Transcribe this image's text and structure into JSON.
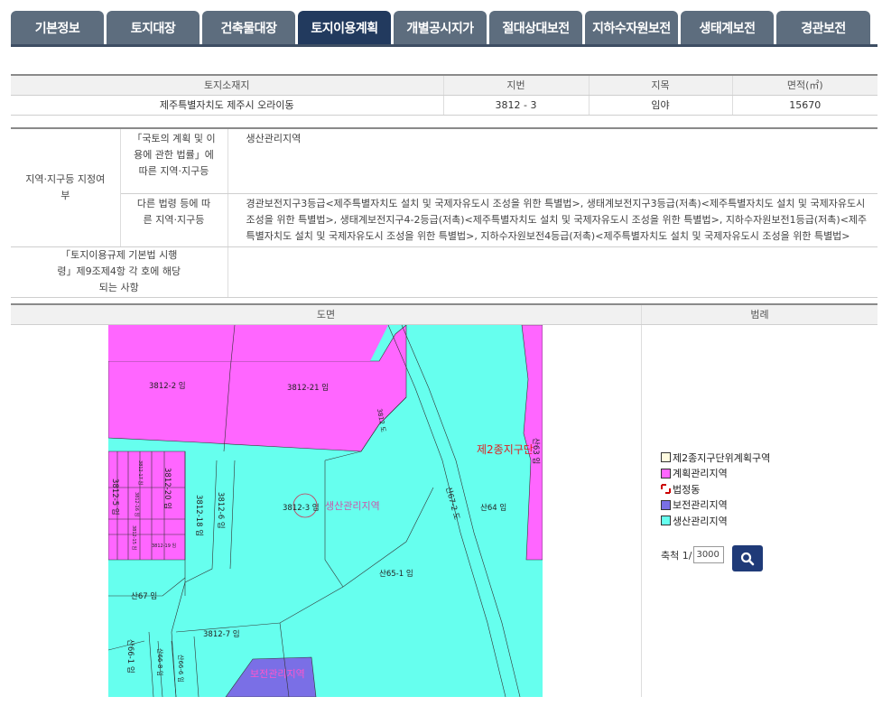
{
  "tabs": [
    {
      "label": "기본정보",
      "active": false
    },
    {
      "label": "토지대장",
      "active": false
    },
    {
      "label": "건축물대장",
      "active": false
    },
    {
      "label": "토지이용계획",
      "active": true
    },
    {
      "label": "개별공시지가",
      "active": false
    },
    {
      "label": "절대상대보전",
      "active": false
    },
    {
      "label": "지하수자원보전",
      "active": false
    },
    {
      "label": "생태계보전",
      "active": false
    },
    {
      "label": "경관보전",
      "active": false
    }
  ],
  "land_info": {
    "headers": [
      "토지소재지",
      "지번",
      "지목",
      "면적(㎡)"
    ],
    "values": [
      "제주특별자치도 제주시 오라이동",
      "3812 - 3",
      "임야",
      "15670"
    ]
  },
  "zoning": {
    "main_header": "지역·지구등 지정여부",
    "national_law_label": "「국토의 계획 및 이용에 관한 법률」에 따른 지역·지구등",
    "national_law_value": "생산관리지역",
    "other_law_label": "다른 법령 등에 따른 지역·지구등",
    "other_law_value": "경관보전지구3등급<제주특별자치도 설치 및 국제자유도시 조성을 위한 특별법>, 생태계보전지구3등급(저촉)<제주특별자치도 설치 및 국제자유도시 조성을 위한 특별법>, 생태계보전지구4-2등급(저촉)<제주특별자치도 설치 및 국제자유도시 조성을 위한 특별법>, 지하수자원보전1등급(저촉)<제주특별자치도 설치 및 국제자유도시 조성을 위한 특별법>, 지하수자원보전4등급(저촉)<제주특별자치도 설치 및 국제자유도시 조성을 위한 특별법>",
    "regulation_label": "「토지이용규제 기본법 시행령」제9조제4항 각 호에 해당되는 사항",
    "regulation_value": ""
  },
  "map_section": {
    "map_header": "도면",
    "legend_header": "범례",
    "map_labels": {
      "p1": "3812-2 임",
      "p2": "3812-21 임",
      "p3": "3812-3 임",
      "p3_zone": "생산관리지역",
      "p4": "3812-20 임",
      "p5": "3812-18 임",
      "p6": "3812-6 임",
      "p7": "3812-5 임",
      "p8": "3812-7 임",
      "p9": "산67 임",
      "p10": "산65-1 임",
      "p11": "산64 임",
      "p12": "산66-1 임",
      "p13": "산66-8 임",
      "p14": "산66-6 임",
      "p15": "산63 임",
      "road1": "3812 도",
      "road2": "산67-2 도",
      "small1": "3812-17 임",
      "small2": "3812-16 임",
      "small3": "3812-15 임",
      "small4": "3812-19 임",
      "zone_red": "제2종지구단",
      "zone_blue": "보전관리지역"
    },
    "legend": [
      {
        "label": "제2종지구단위계획구역",
        "color": "#fffbe0",
        "type": "box"
      },
      {
        "label": "계획관리지역",
        "color": "#ff66ff",
        "type": "box"
      },
      {
        "label": "법정동",
        "color": "#cc0000",
        "type": "corner"
      },
      {
        "label": "보전관리지역",
        "color": "#7a6fe6",
        "type": "box"
      },
      {
        "label": "생산관리지역",
        "color": "#66ffee",
        "type": "box"
      }
    ],
    "scale_label": "축척 1/",
    "scale_value": "3000"
  }
}
